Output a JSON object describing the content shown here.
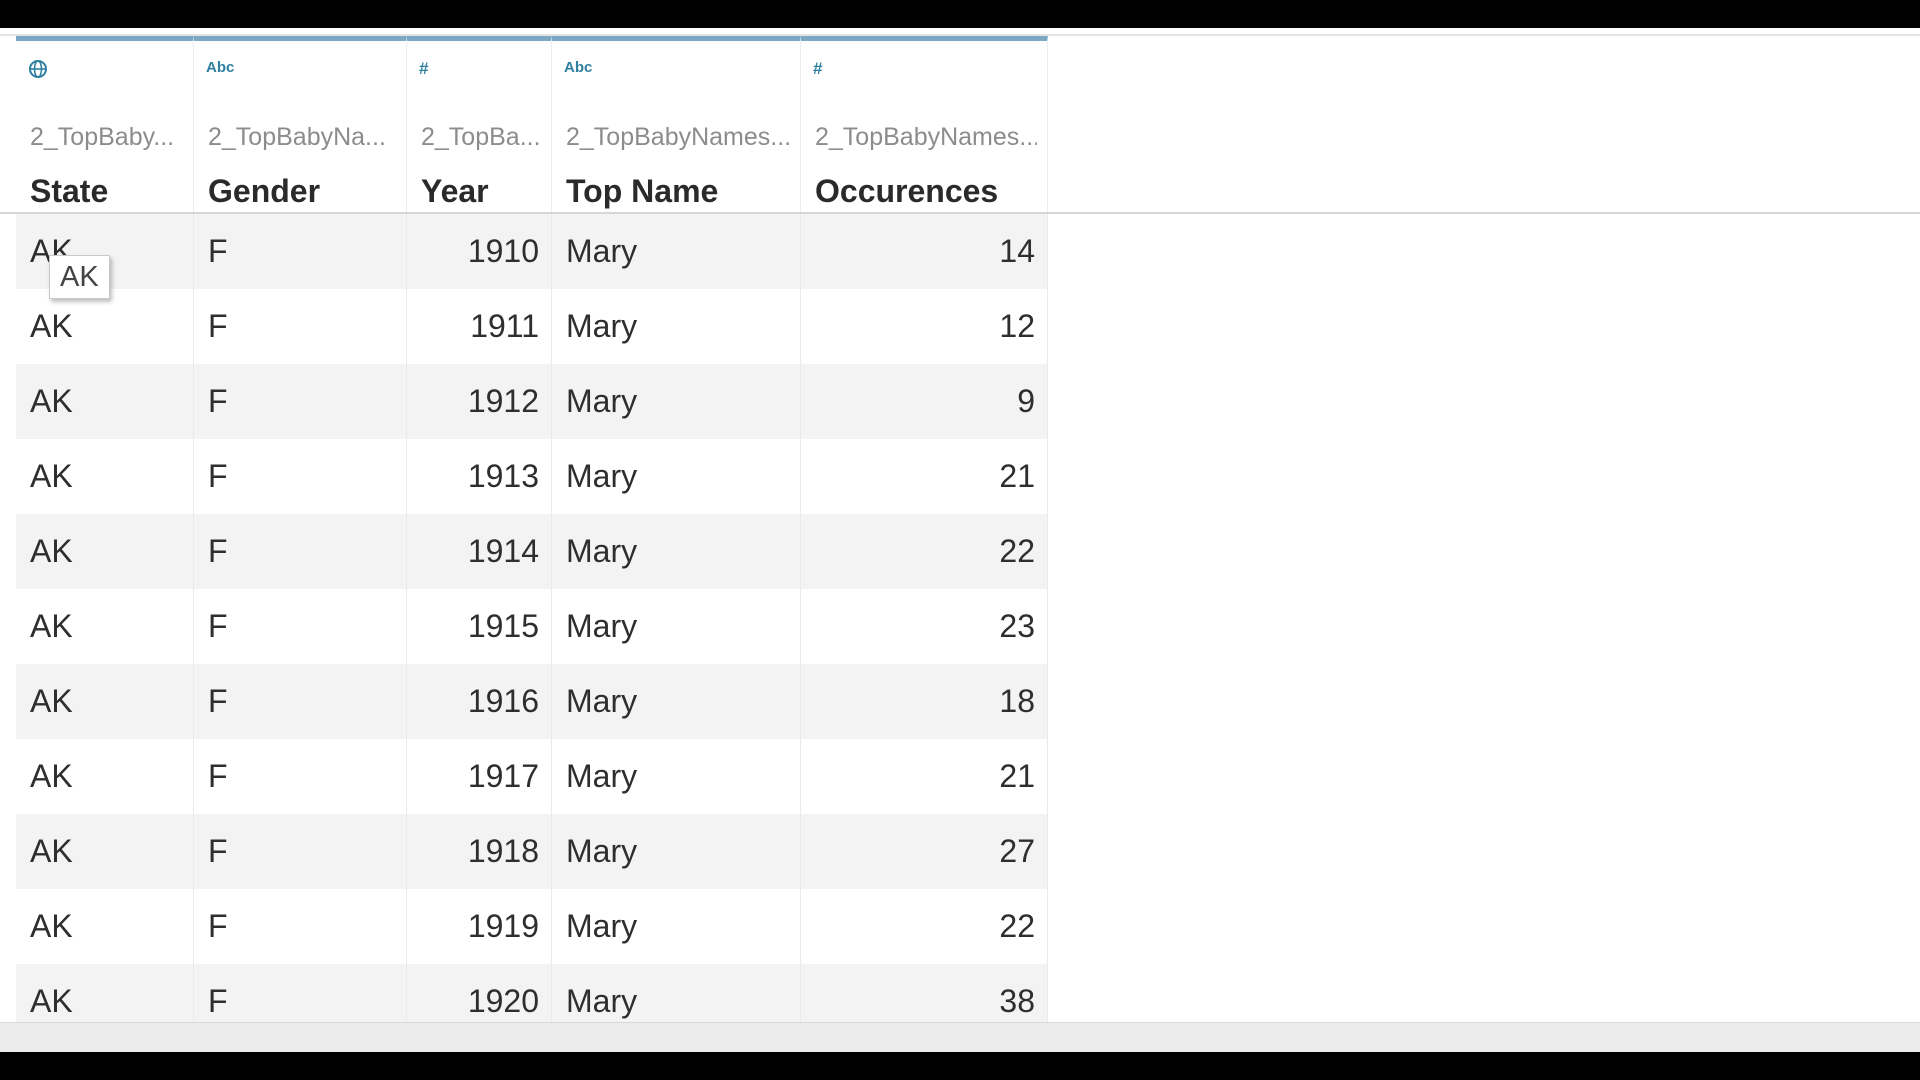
{
  "table": {
    "columns": [
      {
        "type_icon": "globe-icon",
        "source": "2_TopBaby...",
        "name": "State"
      },
      {
        "type_icon": "Abc",
        "source": "2_TopBabyNa...",
        "name": "Gender"
      },
      {
        "type_icon": "#",
        "source": "2_TopBa...",
        "name": "Year"
      },
      {
        "type_icon": "Abc",
        "source": "2_TopBabyNames...",
        "name": "Top Name"
      },
      {
        "type_icon": "#",
        "source": "2_TopBabyNames...",
        "name": "Occurences"
      }
    ],
    "rows": [
      {
        "state": "AK",
        "gender": "F",
        "year": "1910",
        "name": "Mary",
        "occ": "14"
      },
      {
        "state": "AK",
        "gender": "F",
        "year": "1911",
        "name": "Mary",
        "occ": "12"
      },
      {
        "state": "AK",
        "gender": "F",
        "year": "1912",
        "name": "Mary",
        "occ": "9"
      },
      {
        "state": "AK",
        "gender": "F",
        "year": "1913",
        "name": "Mary",
        "occ": "21"
      },
      {
        "state": "AK",
        "gender": "F",
        "year": "1914",
        "name": "Mary",
        "occ": "22"
      },
      {
        "state": "AK",
        "gender": "F",
        "year": "1915",
        "name": "Mary",
        "occ": "23"
      },
      {
        "state": "AK",
        "gender": "F",
        "year": "1916",
        "name": "Mary",
        "occ": "18"
      },
      {
        "state": "AK",
        "gender": "F",
        "year": "1917",
        "name": "Mary",
        "occ": "21"
      },
      {
        "state": "AK",
        "gender": "F",
        "year": "1918",
        "name": "Mary",
        "occ": "27"
      },
      {
        "state": "AK",
        "gender": "F",
        "year": "1919",
        "name": "Mary",
        "occ": "22"
      },
      {
        "state": "AK",
        "gender": "F",
        "year": "1920",
        "name": "Mary",
        "occ": "38"
      }
    ]
  },
  "tooltip": {
    "text": "AK"
  },
  "colors": {
    "accent": "#7aa7c4",
    "icon": "#2f7fa0",
    "row_shade": "#f2f3f2"
  }
}
